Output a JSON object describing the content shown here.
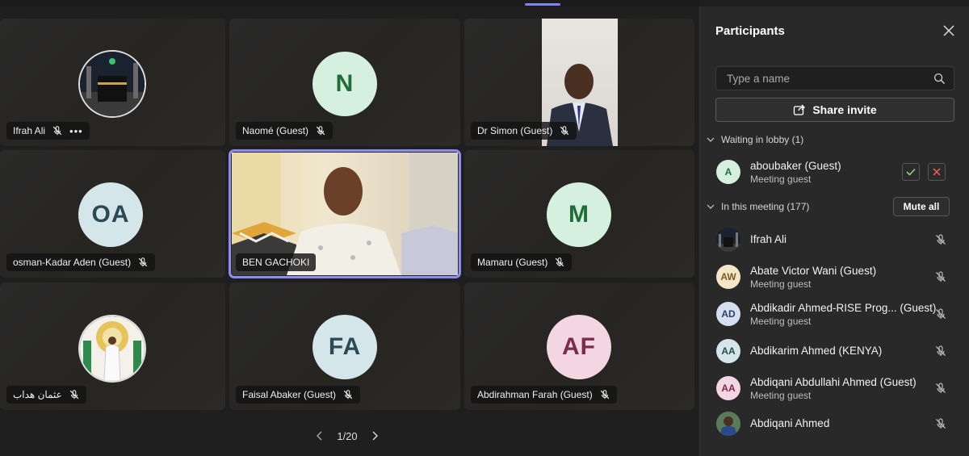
{
  "pager": {
    "page": "1/20"
  },
  "tiles": [
    {
      "name": "Ifrah Ali",
      "more": "•••"
    },
    {
      "initial": "N",
      "name": "Naomé (Guest)",
      "bg": "#d6f0e0",
      "fg": "#1f6e3a"
    },
    {
      "name": "Dr Simon (Guest)"
    },
    {
      "initial": "OA",
      "name": "osman-Kadar Aden (Guest)",
      "bg": "#d5e6ea",
      "fg": "#2b4a55"
    },
    {
      "name": "BEN GACHOKI"
    },
    {
      "initial": "M",
      "name": "Mamaru (Guest)",
      "bg": "#d6f0e0",
      "fg": "#1f6e3a"
    },
    {
      "name": "عثمان هداب"
    },
    {
      "initial": "FA",
      "name": "Faisal Abaker (Guest)",
      "bg": "#d5e6ea",
      "fg": "#2b4a55"
    },
    {
      "initial": "AF",
      "name": "Abdirahman Farah (Guest)",
      "bg": "#f4d5e2",
      "fg": "#7a2b4e"
    }
  ],
  "panel": {
    "title": "Participants",
    "search_placeholder": "Type a name",
    "share_label": "Share invite",
    "lobby_label": "Waiting in lobby (1)",
    "meeting_label": "In this meeting (177)",
    "mute_all_label": "Mute all",
    "lobby": [
      {
        "initial": "A",
        "name": "aboubaker (Guest)",
        "sub": "Meeting guest"
      }
    ],
    "participants": [
      {
        "initial": "",
        "name": "Ifrah Ali",
        "sub": ""
      },
      {
        "initial": "AW",
        "name": "Abate Victor Wani (Guest)",
        "sub": "Meeting guest"
      },
      {
        "initial": "AD",
        "name": "Abdikadir Ahmed-RISE Prog... (Guest)",
        "sub": "Meeting guest"
      },
      {
        "initial": "AA",
        "name": "Abdikarim Ahmed (KENYA)",
        "sub": ""
      },
      {
        "initial": "AA",
        "name": "Abdiqani Abdullahi Ahmed (Guest)",
        "sub": "Meeting guest"
      },
      {
        "initial": "",
        "name": "Abdiqani Ahmed",
        "sub": ""
      }
    ]
  },
  "colors": {
    "accent": "#8d8df0",
    "accept": "#8fd17a",
    "reject": "#e05a5a"
  }
}
